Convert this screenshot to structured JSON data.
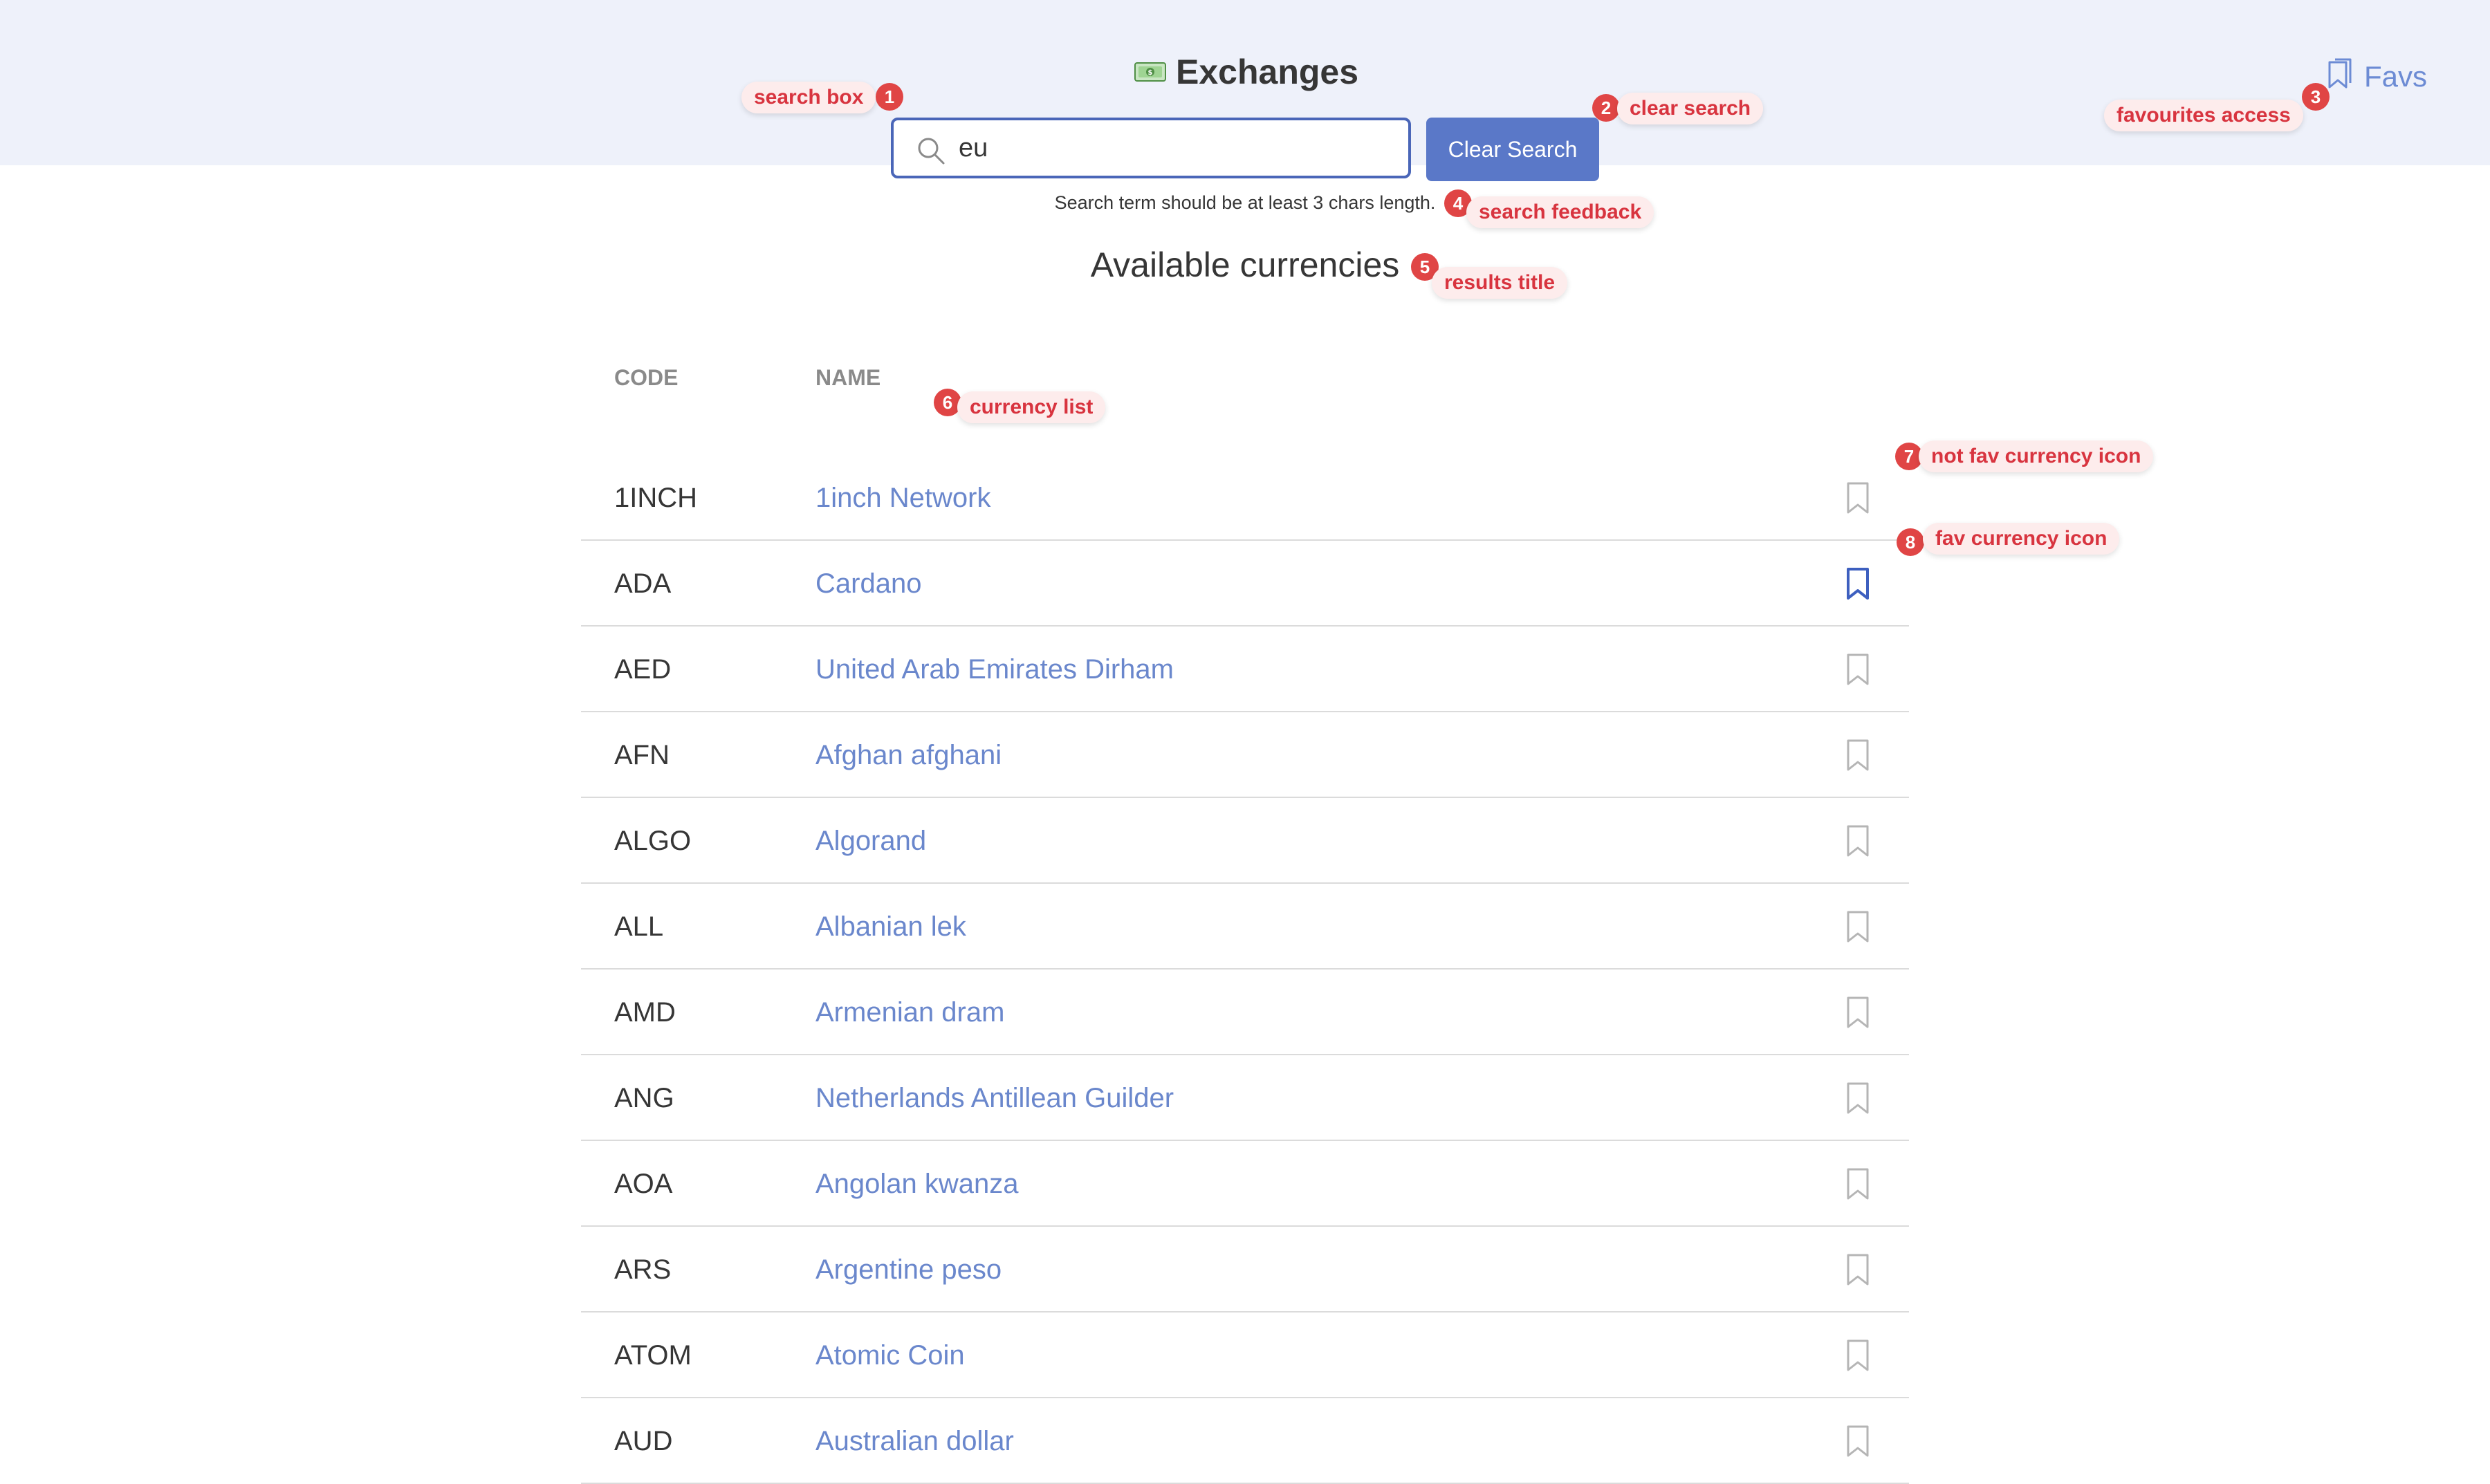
{
  "header": {
    "title": "Exchanges",
    "favs_label": "Favs",
    "money_icon": "banknote-icon",
    "favs_icon": "bookmarks-icon"
  },
  "search": {
    "value": "eu",
    "placeholder": "",
    "clear_label": "Clear Search",
    "feedback": "Search term should be at least 3 chars length."
  },
  "results": {
    "title": "Available currencies",
    "columns": [
      "CODE",
      "NAME"
    ],
    "rows": [
      {
        "code": "1INCH",
        "name": "1inch Network",
        "fav": false
      },
      {
        "code": "ADA",
        "name": "Cardano",
        "fav": true
      },
      {
        "code": "AED",
        "name": "United Arab Emirates Dirham",
        "fav": false
      },
      {
        "code": "AFN",
        "name": "Afghan afghani",
        "fav": false
      },
      {
        "code": "ALGO",
        "name": "Algorand",
        "fav": false
      },
      {
        "code": "ALL",
        "name": "Albanian lek",
        "fav": false
      },
      {
        "code": "AMD",
        "name": "Armenian dram",
        "fav": false
      },
      {
        "code": "ANG",
        "name": "Netherlands Antillean Guilder",
        "fav": false
      },
      {
        "code": "AOA",
        "name": "Angolan kwanza",
        "fav": false
      },
      {
        "code": "ARS",
        "name": "Argentine peso",
        "fav": false
      },
      {
        "code": "ATOM",
        "name": "Atomic Coin",
        "fav": false
      },
      {
        "code": "AUD",
        "name": "Australian dollar",
        "fav": false
      }
    ]
  },
  "annotations": [
    {
      "num": "1",
      "label": "search box"
    },
    {
      "num": "2",
      "label": "clear search"
    },
    {
      "num": "3",
      "label": "favourites access"
    },
    {
      "num": "4",
      "label": "search feedback"
    },
    {
      "num": "5",
      "label": "results title"
    },
    {
      "num": "6",
      "label": "currency list"
    },
    {
      "num": "7",
      "label": "not fav currency  icon"
    },
    {
      "num": "8",
      "label": "fav currency icon"
    }
  ],
  "colors": {
    "header_bg": "#eef1fa",
    "accent": "#5a78c8",
    "link": "#6a87cc",
    "fav_active": "#3d5fbf",
    "fav_inactive": "#b5b5b5",
    "annotation": "#e04545"
  }
}
